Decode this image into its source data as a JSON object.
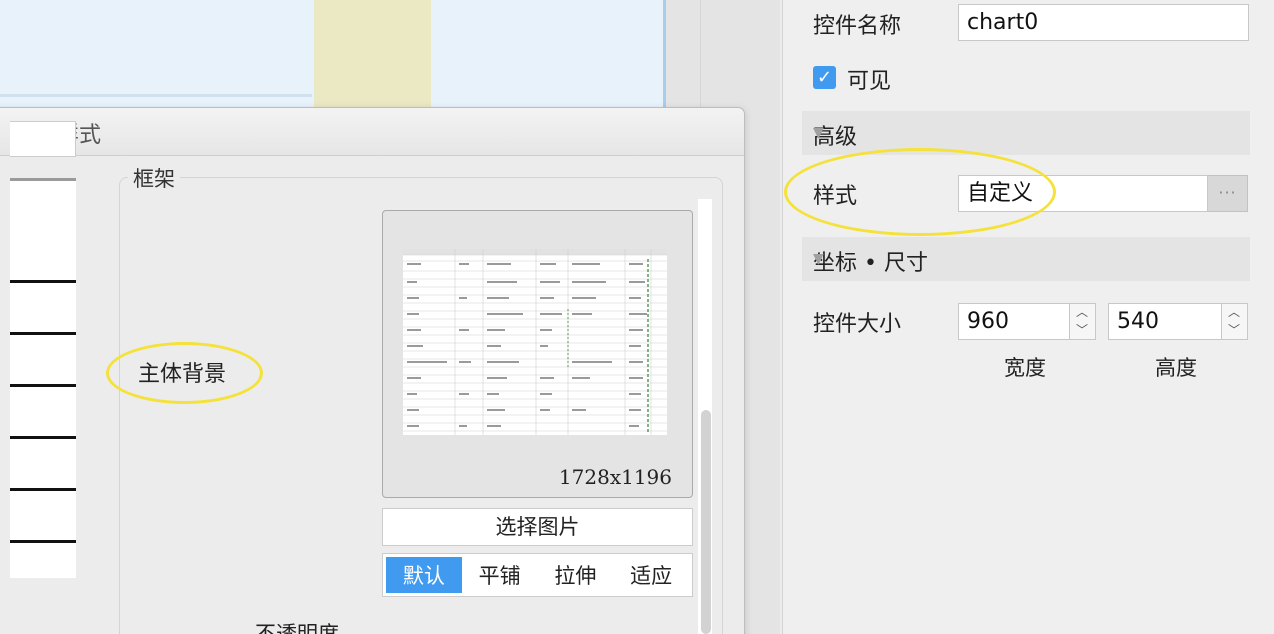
{
  "dialog": {
    "title": "样式",
    "frame_legend": "框架",
    "body_background_label": "主体背景",
    "preview_size": "1728x1196",
    "choose_image": "选择图片",
    "fill_modes": [
      {
        "label": "默认",
        "active": true
      },
      {
        "label": "平铺",
        "active": false
      },
      {
        "label": "拉伸",
        "active": false
      },
      {
        "label": "适应",
        "active": false
      }
    ],
    "opacity_label": "不透明度"
  },
  "panel": {
    "control_name_label": "控件名称",
    "control_name_value": "chart0",
    "visible_label": "可见",
    "visible_checked": true,
    "advanced_section": "高级",
    "style_label": "样式",
    "style_value": "自定义",
    "more_button": "···",
    "coords_section": "坐标 • 尺寸",
    "size_label": "控件大小",
    "width_value": "960",
    "height_value": "540",
    "width_caption": "宽度",
    "height_caption": "高度"
  },
  "colors": {
    "accent": "#3f9af0",
    "highlight": "#f4e23a"
  }
}
